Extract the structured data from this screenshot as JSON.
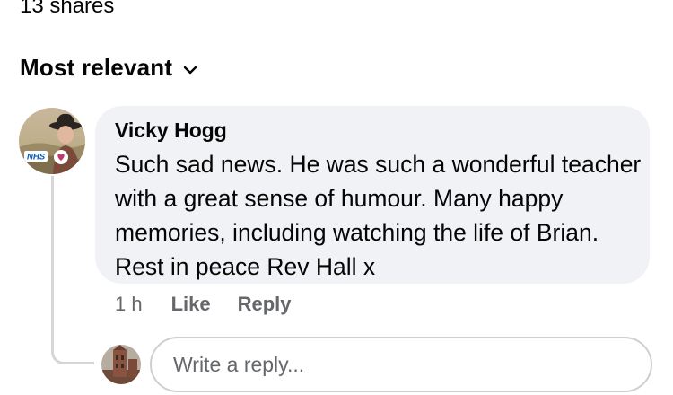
{
  "post": {
    "shares_text": "13 shares"
  },
  "sort": {
    "label": "Most relevant",
    "icon": "chevron-down-icon"
  },
  "comment": {
    "author": "Vicky Hogg",
    "text": "Such sad news. He was such a wonderful teacher with a great sense of humour. Many happy memories, including watching the life of Brian. Rest in peace Rev Hall x",
    "time": "1 h",
    "like_label": "Like",
    "reply_label": "Reply",
    "avatar_badge": "NHS"
  },
  "reply": {
    "placeholder": "Write a reply..."
  },
  "colors": {
    "bubble": "#f0f2f5",
    "secondary_text": "#65676b",
    "nhs_blue": "#005eb8"
  }
}
